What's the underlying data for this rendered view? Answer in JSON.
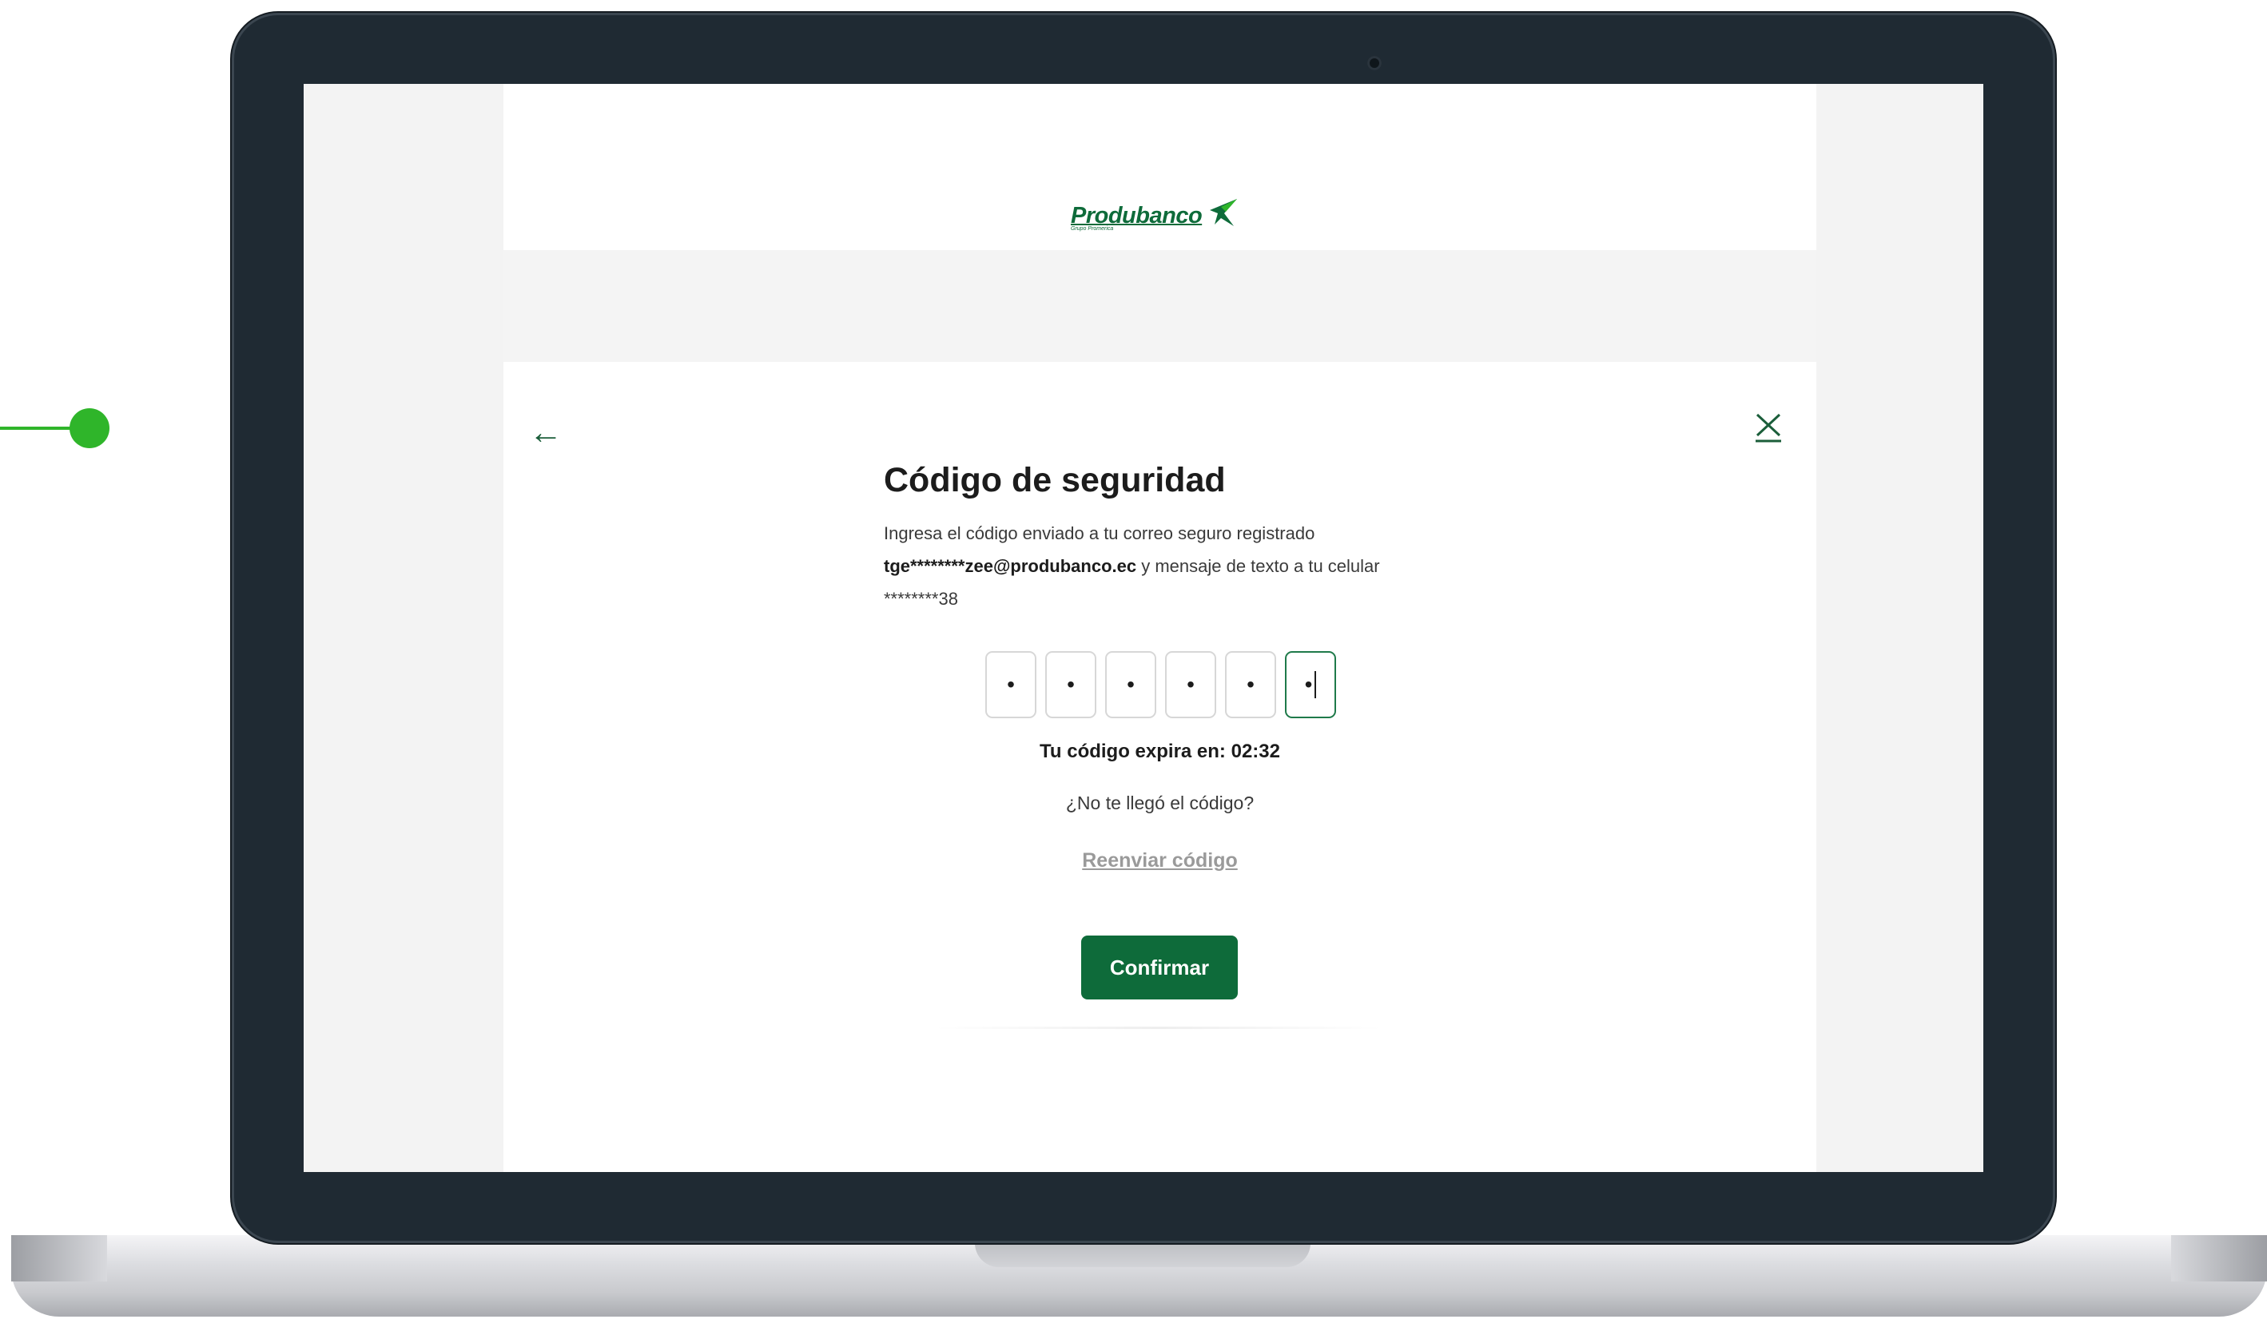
{
  "brand": {
    "name": "Produbanco",
    "tagline": "Grupo Promerica",
    "color": "#0e6b3a"
  },
  "accent_callout_color": "#2fb52a",
  "nav": {
    "back_icon": "arrow-left-icon",
    "back_glyph": "←",
    "close_icon": "close-icon"
  },
  "security": {
    "title": "Código de seguridad",
    "desc_prefix": "Ingresa el código enviado a tu correo seguro registrado",
    "email": "tge********zee@produbanco.ec",
    "desc_mid": " y mensaje de texto a tu celular ",
    "phone": "********38"
  },
  "otp": {
    "digits": [
      "•",
      "•",
      "•",
      "•",
      "•",
      "•"
    ],
    "active_index": 5
  },
  "timer_text": "Tu código expira en: 02:32",
  "no_code_text": "¿No te llegó el código?",
  "resend_label": "Reenviar código",
  "confirm_label": "Confirmar"
}
